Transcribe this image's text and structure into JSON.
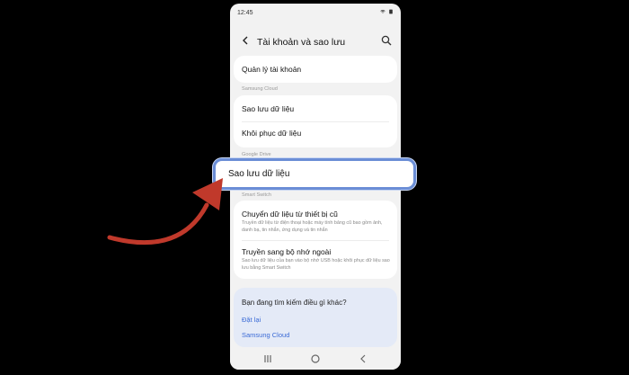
{
  "status_bar": {
    "time": "12:45"
  },
  "header": {
    "title": "Tài khoản và sao lưu"
  },
  "items": {
    "account_manage": "Quản lý tài khoản",
    "backup": "Sao lưu dữ liệu",
    "restore": "Khôi phục dữ liệu",
    "transfer_old": "Chuyển dữ liệu từ thiết bị cũ",
    "transfer_old_desc": "Truyền dữ liệu từ điện thoại hoặc máy tính bảng cũ bao gồm ảnh, danh bạ, tin nhắn, ứng dụng và tin nhắn",
    "transfer_external": "Truyền sang bộ nhớ ngoài",
    "transfer_external_desc": "Sao lưu dữ liệu của bạn vào bộ nhớ USB hoặc khôi phục dữ liệu sao lưu bằng Smart Switch"
  },
  "sections": {
    "samsung_cloud": "Samsung Cloud",
    "google_drive": "Google Drive",
    "smart_switch": "Smart Switch"
  },
  "highlight": {
    "label": "Sao lưu dữ liệu"
  },
  "suggest": {
    "title": "Bạn đang tìm kiếm điều gì khác?",
    "links": [
      "Đặt lại",
      "Samsung Cloud"
    ]
  },
  "colors": {
    "accent": "#6b8ed6",
    "link": "#3b6bd6",
    "arrow": "#c0392b"
  },
  "icons": [
    "back-arrow-icon",
    "search-icon",
    "wifi-icon",
    "battery-icon",
    "recent-apps-icon",
    "home-icon",
    "back-nav-icon"
  ]
}
